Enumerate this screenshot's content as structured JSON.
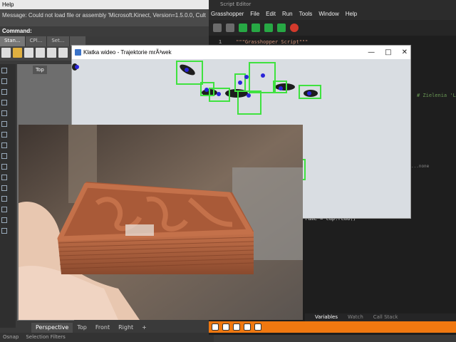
{
  "rhino": {
    "menu_help": "Help",
    "message": "Message: Could not load file or assembly 'Microsoft.Kinect, Version=1.5.0.0, Cult",
    "command_label": "Command:",
    "tabs": [
      "Stan...",
      "CPl...",
      "Set..."
    ],
    "viewport_label": "Top",
    "viewport_tabs": [
      "Perspective",
      "Top",
      "Front",
      "Right",
      "+"
    ],
    "status": [
      "Osnap",
      "Selection Filters"
    ]
  },
  "script_editor": {
    "title": "Script Editor",
    "menu": [
      "Grasshopper",
      "File",
      "Edit",
      "Run",
      "Tools",
      "Window",
      "Help"
    ],
    "line_number": "1",
    "line1_text": "\"\"\"Grasshopper Script\"\"\"",
    "comment": "# Zielenia 'L",
    "side_note": "...none",
    "code_frame": "rame = cap.read()",
    "bottom_tabs": [
      "Variables",
      "Watch",
      "Call Stack"
    ],
    "toolbar_colors": [
      "#6b6b6b",
      "#6b6b6b",
      "#27a844",
      "#27a844",
      "#27a844",
      "#27a844",
      "#d33a2c"
    ]
  },
  "video_window": {
    "title": "Klatka wideo - Trajektorie mrÃ³wek",
    "controls": [
      "minimize",
      "maximize",
      "close"
    ],
    "detection_color": "#3fe23f",
    "point_color": "#2a24d8"
  },
  "colors": {
    "orange_bar": "#f07810",
    "brand_blue": "#3b73c8"
  }
}
